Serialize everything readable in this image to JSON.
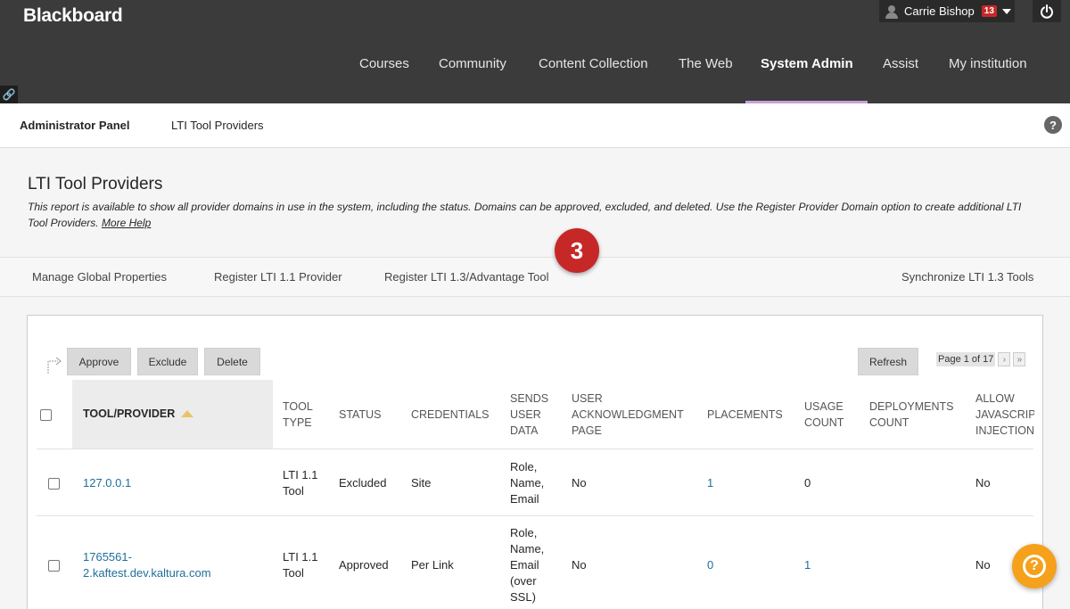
{
  "header": {
    "logo": "Blackboard",
    "user_name": "Carrie Bishop",
    "notification_count": "13",
    "nav": [
      "Courses",
      "Community",
      "Content Collection",
      "The Web",
      "System Admin",
      "Assist",
      "My institution"
    ],
    "active_nav": "System Admin"
  },
  "breadcrumb": {
    "panel": "Administrator Panel",
    "current": "LTI Tool Providers",
    "help": "?"
  },
  "page": {
    "title": "LTI Tool Providers",
    "description": "This report is available to show all provider domains in use in the system, including the status. Domains can be approved, excluded, and deleted. Use the Register Provider Domain option to create additional LTI Tool Providers.",
    "more_help": "More Help"
  },
  "actions": {
    "manage": "Manage Global Properties",
    "register_11": "Register LTI 1.1 Provider",
    "register_13": "Register LTI 1.3/Advantage Tool",
    "sync": "Synchronize LTI 1.3 Tools"
  },
  "step_number": "3",
  "toolbar": {
    "approve": "Approve",
    "exclude": "Exclude",
    "delete": "Delete",
    "refresh": "Refresh",
    "page_info": "Page 1 of 17"
  },
  "table": {
    "columns": {
      "tool_provider": "TOOL/PROVIDER",
      "tool_type": [
        "TOOL",
        "TYPE"
      ],
      "status": "STATUS",
      "credentials": "CREDENTIALS",
      "sends_user_data": [
        "SENDS",
        "USER",
        "DATA"
      ],
      "user_ack": [
        "USER",
        "ACKNOWLEDGMENT",
        "PAGE"
      ],
      "placements": "PLACEMENTS",
      "usage_count": [
        "USAGE",
        "COUNT"
      ],
      "deployments_count": [
        "DEPLOYMENTS",
        "COUNT"
      ],
      "allow_js": [
        "ALLOW",
        "JAVASCRIPT",
        "INJECTION"
      ]
    },
    "rows": [
      {
        "provider": [
          "127.0.0.1"
        ],
        "tool_type": [
          "LTI 1.1",
          "Tool"
        ],
        "status": "Excluded",
        "credentials": "Site",
        "sends_user_data": [
          "Role,",
          "Name,",
          "Email"
        ],
        "user_ack": "No",
        "placements": "1",
        "usage_count": "0",
        "allow_js": "No"
      },
      {
        "provider": [
          "1765561-",
          "2.kaftest.dev.kaltura.com"
        ],
        "tool_type": [
          "LTI 1.1",
          "Tool"
        ],
        "status": "Approved",
        "credentials": "Per Link",
        "sends_user_data": [
          "Role,",
          "Name,",
          "Email",
          "(over",
          "SSL)"
        ],
        "user_ack": "No",
        "placements": "0",
        "usage_count": "1",
        "allow_js": "No"
      }
    ]
  }
}
